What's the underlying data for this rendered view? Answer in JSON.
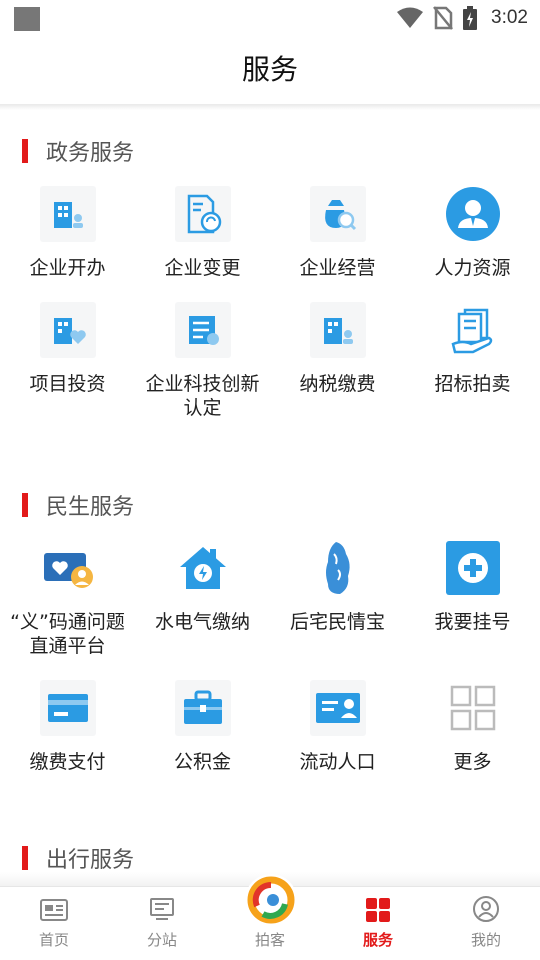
{
  "status_bar": {
    "time": "3:02"
  },
  "header": {
    "title": "服务"
  },
  "sections": [
    {
      "title": "政务服务",
      "items": [
        {
          "label": "企业开办",
          "icon": "building-icon"
        },
        {
          "label": "企业变更",
          "icon": "document-refresh-icon"
        },
        {
          "label": "企业经营",
          "icon": "money-bag-icon"
        },
        {
          "label": "人力资源",
          "icon": "person-icon"
        },
        {
          "label": "项目投资",
          "icon": "building-heart-icon"
        },
        {
          "label": "企业科技创新认定",
          "icon": "server-icon"
        },
        {
          "label": "纳税缴费",
          "icon": "building-user-icon"
        },
        {
          "label": "招标拍卖",
          "icon": "hand-documents-icon"
        }
      ]
    },
    {
      "title": "民生服务",
      "items": [
        {
          "label": "“义”码通问题直通平台",
          "icon": "heart-card-icon"
        },
        {
          "label": "水电气缴纳",
          "icon": "house-bolt-icon"
        },
        {
          "label": "后宅民情宝",
          "icon": "stone-icon"
        },
        {
          "label": "我要挂号",
          "icon": "medical-plus-icon"
        },
        {
          "label": "缴费支付",
          "icon": "card-icon"
        },
        {
          "label": "公积金",
          "icon": "briefcase-icon"
        },
        {
          "label": "流动人口",
          "icon": "id-card-icon"
        },
        {
          "label": "更多",
          "icon": "grid-icon"
        }
      ]
    },
    {
      "title": "出行服务"
    }
  ],
  "bottom_nav": [
    {
      "label": "首页",
      "icon": "newspaper-icon"
    },
    {
      "label": "分站",
      "icon": "station-icon"
    },
    {
      "label": "拍客",
      "icon": "camera-logo-icon"
    },
    {
      "label": "服务",
      "icon": "apps-icon",
      "active": true
    },
    {
      "label": "我的",
      "icon": "profile-icon"
    }
  ],
  "colors": {
    "accent": "#e21a1a",
    "icon_blue": "#2b9be3"
  }
}
